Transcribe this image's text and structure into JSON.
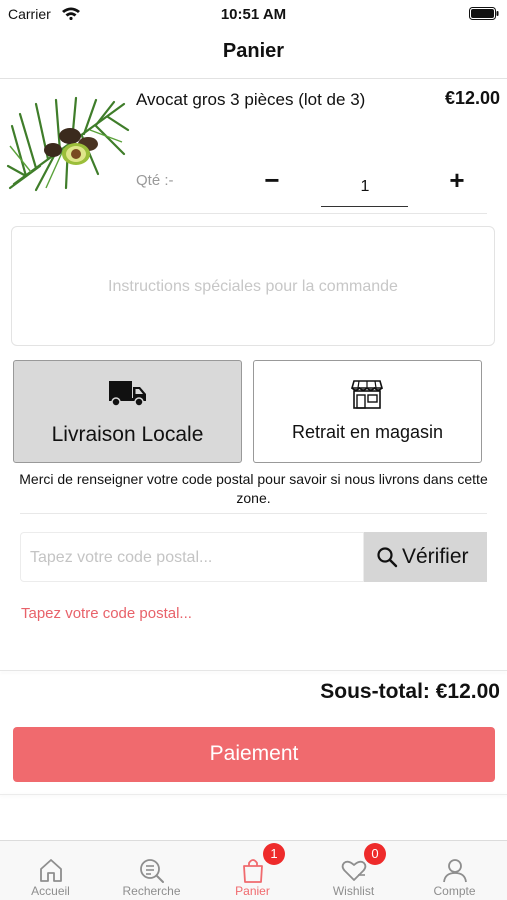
{
  "status_bar": {
    "carrier": "Carrier",
    "time": "10:51 AM"
  },
  "nav": {
    "title": "Panier"
  },
  "cart_item": {
    "name": "Avocat gros 3 pièces (lot de 3)",
    "price": "€12.00",
    "qty_label": "Qté :-",
    "minus": "−",
    "quantity": "1",
    "plus": "+"
  },
  "instructions": {
    "placeholder": "Instructions spéciales pour la commande"
  },
  "delivery": {
    "local_label": "Livraison Locale",
    "local_icon": "truck-icon",
    "store_label": "Retrait en magasin",
    "store_icon": "store-icon",
    "selected": "local",
    "info": "Merci de renseigner votre code postal pour savoir si nous livrons dans cette zone."
  },
  "postal": {
    "placeholder": "Tapez votre code postal...",
    "verify_label": "Vérifier",
    "verify_icon": "search-icon",
    "error": "Tapez votre code postal..."
  },
  "summary": {
    "subtotal": "Sous-total: €12.00",
    "pay_label": "Paiement"
  },
  "tabs": [
    {
      "label": "Accueil",
      "icon": "home-icon",
      "active": false
    },
    {
      "label": "Recherche",
      "icon": "search-list-icon",
      "active": false
    },
    {
      "label": "Panier",
      "icon": "bag-icon",
      "active": true,
      "badge": "1"
    },
    {
      "label": "Wishlist",
      "icon": "heart-icon",
      "active": false,
      "badge": "0"
    },
    {
      "label": "Compte",
      "icon": "user-icon",
      "active": false
    }
  ],
  "colors": {
    "accent": "#f06a6e",
    "badge": "#ee2b2b",
    "selected_option_bg": "#d9d9d9",
    "verify_bg": "#d6d6d6"
  }
}
